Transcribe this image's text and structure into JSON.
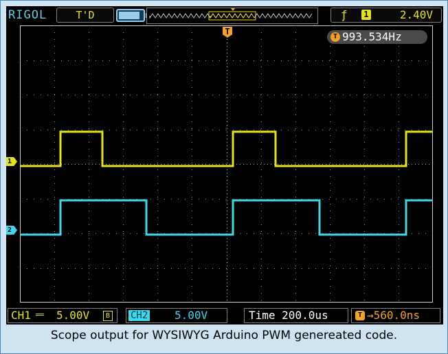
{
  "header": {
    "brand": "RIGOL",
    "trigger_status": "T'D",
    "trigger_edge_symbol": "↑",
    "trigger_source": "1",
    "trigger_level": "2.40V"
  },
  "display": {
    "trigger_marker": "T",
    "frequency_icon": "T",
    "frequency": "993.534Hz",
    "ch1_marker": "1",
    "ch2_marker": "2"
  },
  "footer": {
    "ch1_label": "CH1",
    "ch1_coupling_symbol": "══",
    "ch1_scale": "5.00V",
    "ch1_bw_limit": "B",
    "ch2_label": "CH2",
    "ch2_scale": "5.00V",
    "timebase": "Time 200.0us",
    "trigger_offset_icon": "T",
    "trigger_offset": "→560.0ns"
  },
  "caption": "Scope output for WYSIWYG Arduino PWM genereated code.",
  "colors": {
    "ch1": "#e3e41c",
    "ch2": "#3fd7ea",
    "trigger": "#f1a321",
    "background": "#000000",
    "page": "#cfe3f1"
  },
  "icons": [
    "battery-icon",
    "rising-edge-icon",
    "trigger-marker-icon",
    "ch1-ground-marker-icon",
    "ch2-ground-marker-icon"
  ]
}
